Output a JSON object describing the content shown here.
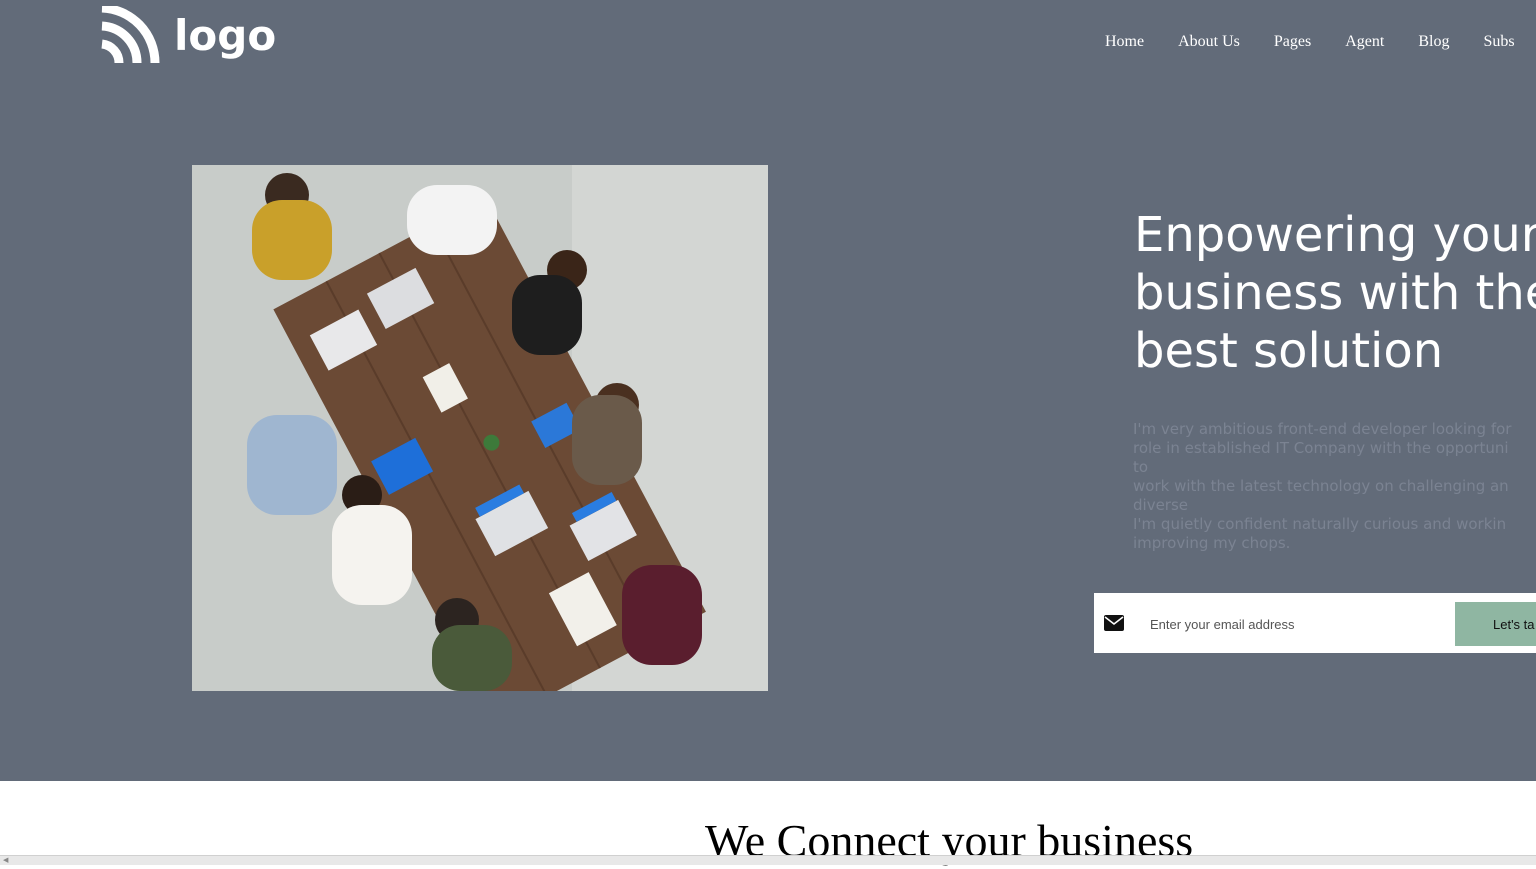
{
  "header": {
    "logo_text": "logo",
    "nav": [
      "Home",
      "About Us",
      "Pages",
      "Agent",
      "Blog",
      "Subs"
    ]
  },
  "hero": {
    "headline_lines": [
      "Enpowering your",
      "business with the",
      "best solution"
    ],
    "intro_lines": [
      "I'm very ambitious front-end developer looking for",
      "role in established IT Company with the opportuni",
      "to",
      "work with the latest technology on challenging an",
      "diverse",
      "I'm quietly confident naturally curious and workin",
      "improving my chops."
    ],
    "email_placeholder": "Enter your email address",
    "cta_label": "Let's ta",
    "mail_icon": "envelope-icon"
  },
  "section": {
    "title": "We Connect your business"
  },
  "colors": {
    "hero_bg": "#626b79",
    "cta_bg": "#8fb6a2",
    "intro_text": "#7b8392"
  }
}
